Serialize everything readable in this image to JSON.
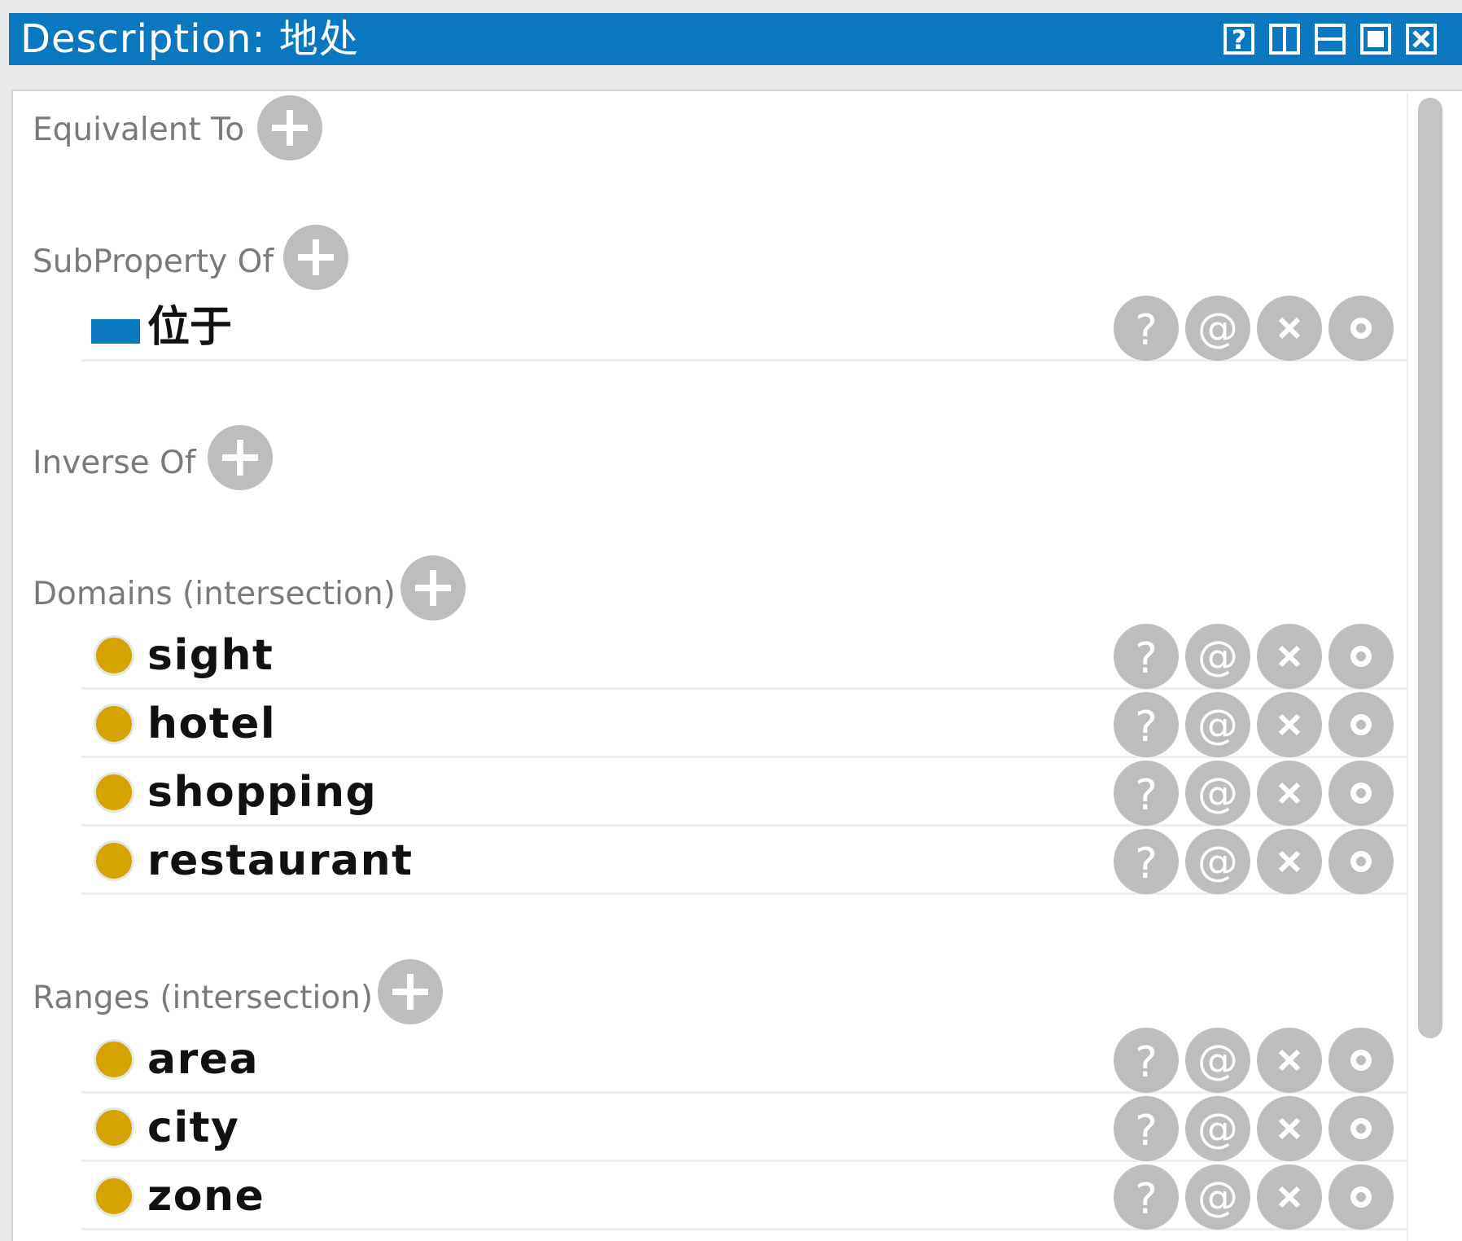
{
  "window": {
    "title": "Description: 地处",
    "help_icon_glyph": "?",
    "controls": [
      "help-icon",
      "split-vertical-icon",
      "split-horizontal-icon",
      "maximize-icon",
      "close-icon"
    ]
  },
  "colors": {
    "titlebar": "#0a78c0",
    "class_dot": "#d4a400",
    "property_marker": "#0a78c0",
    "button_gray": "#bdbdbd"
  },
  "row_actions": {
    "help": "?",
    "annotate": "@",
    "delete_icon": "close-icon",
    "options_icon": "circle-icon"
  },
  "sections": {
    "equivalent_to": {
      "label": "Equivalent To",
      "items": []
    },
    "subproperty_of": {
      "label": "SubProperty Of",
      "items": [
        "位于"
      ]
    },
    "inverse_of": {
      "label": "Inverse Of",
      "items": []
    },
    "domains": {
      "label": "Domains (intersection)",
      "items": [
        "sight",
        "hotel",
        "shopping",
        "restaurant"
      ]
    },
    "ranges": {
      "label": "Ranges (intersection)",
      "items": [
        "area",
        "city",
        "zone"
      ]
    }
  }
}
